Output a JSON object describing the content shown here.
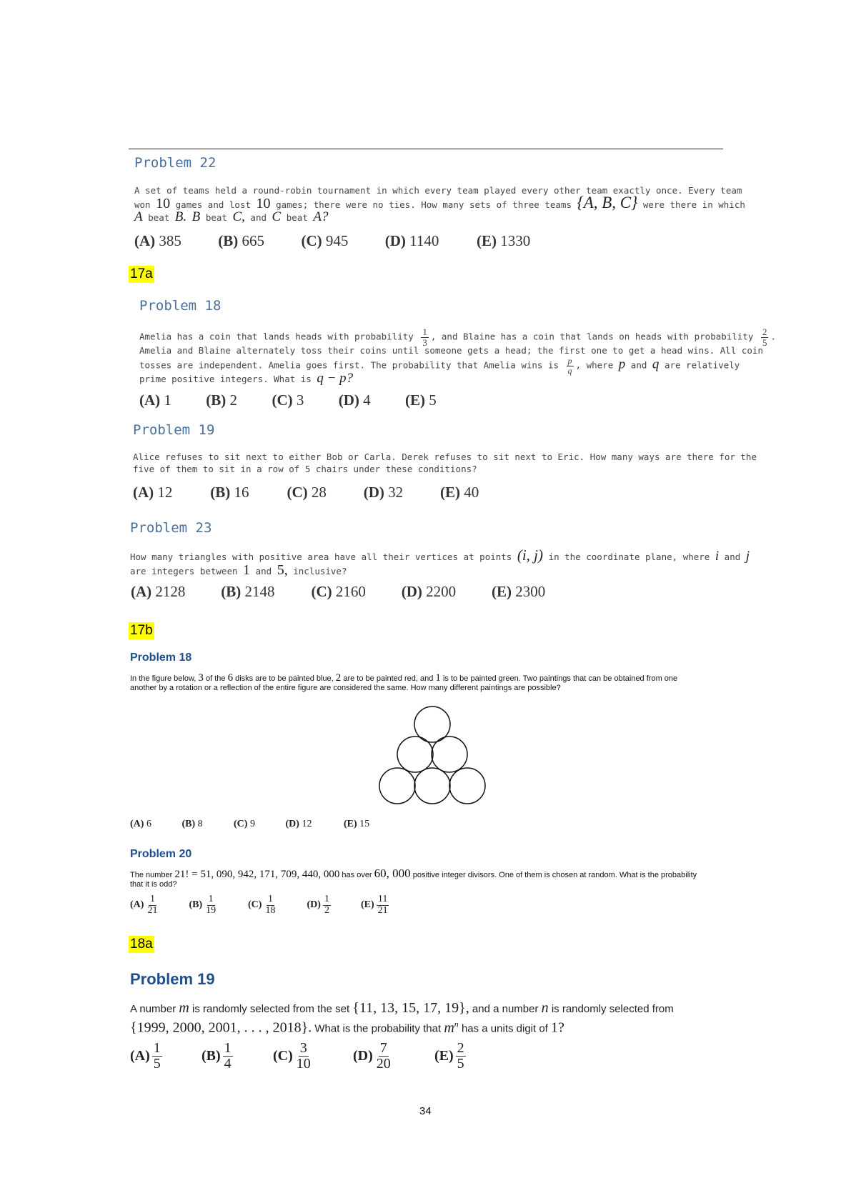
{
  "p22": {
    "title": "Problem 22",
    "line1": "A set of teams held a round-robin tournament in which every team played every other team exactly once. Every team",
    "line2a": "won",
    "n10a": "10",
    "line2b": "games and lost",
    "n10b": "10",
    "line2c": "games; there were no ties. How many sets of three teams",
    "set": "{A, B, C}",
    "line2d": "were there in which",
    "A1": "A",
    "beat1": "beat",
    "B1": "B.",
    "B2": "B",
    "beat2": "beat",
    "C1": "C,",
    "and1": "and",
    "C2": "C",
    "beat3": "beat",
    "A2": "A?",
    "choices": [
      {
        "letter": "(A)",
        "value": "385"
      },
      {
        "letter": "(B)",
        "value": "665"
      },
      {
        "letter": "(C)",
        "value": "945"
      },
      {
        "letter": "(D)",
        "value": "1140"
      },
      {
        "letter": "(E)",
        "value": "1330"
      }
    ]
  },
  "tag17a": "17a",
  "p18a": {
    "title": "Problem 18",
    "l1a": "Amelia has a coin that lands heads with probability",
    "f1n": "1",
    "f1d": "3",
    "comma1": ",",
    "l1b": "and Blaine has a coin that lands on heads with probability",
    "f2n": "2",
    "f2d": "5",
    "dot1": ".",
    "l2": "Amelia and Blaine alternately toss their coins until someone gets a head; the first one to get a head wins. All coin",
    "l3a": "tosses are independent. Amelia goes first. The probability that Amelia wins is",
    "f3n": "p",
    "f3d": "q",
    "comma3": ",",
    "l3b": "where",
    "p": "p",
    "and": "and",
    "q": "q",
    "l3c": "are relatively",
    "l4a": "prime positive integers. What is",
    "expr": "q − p?",
    "choices": [
      {
        "letter": "(A)",
        "value": "1"
      },
      {
        "letter": "(B)",
        "value": "2"
      },
      {
        "letter": "(C)",
        "value": "3"
      },
      {
        "letter": "(D)",
        "value": "4"
      },
      {
        "letter": "(E)",
        "value": "5"
      }
    ]
  },
  "p19a": {
    "title": "Problem 19",
    "l1": "Alice refuses to sit next to either Bob or Carla. Derek refuses to sit next to Eric. How many ways are there for the",
    "l2": "five of them to sit in a row of 5 chairs under these conditions?",
    "choices": [
      {
        "letter": "(A)",
        "value": "12"
      },
      {
        "letter": "(B)",
        "value": "16"
      },
      {
        "letter": "(C)",
        "value": "28"
      },
      {
        "letter": "(D)",
        "value": "32"
      },
      {
        "letter": "(E)",
        "value": "40"
      }
    ]
  },
  "p23": {
    "title": "Problem 23",
    "l1a": "How many triangles with positive area have all their vertices at points",
    "pt": "(i, j)",
    "l1b": "in the coordinate plane, where",
    "i": "i",
    "and": "and",
    "j": "j",
    "l2a": "are integers between",
    "n1": "1",
    "and2": "and",
    "n5": "5,",
    "l2b": "inclusive?",
    "choices": [
      {
        "letter": "(A)",
        "value": "2128"
      },
      {
        "letter": "(B)",
        "value": "2148"
      },
      {
        "letter": "(C)",
        "value": "2160"
      },
      {
        "letter": "(D)",
        "value": "2200"
      },
      {
        "letter": "(E)",
        "value": "2300"
      }
    ]
  },
  "tag17b": "17b",
  "p18b": {
    "title": "Problem 18",
    "l1a": "In the figure below,",
    "n3": "3",
    "l1b": "of the",
    "n6": "6",
    "l1c": "disks are to be painted blue,",
    "n2": "2",
    "l1d": "are to be painted red, and",
    "n1": "1",
    "l1e": "is to be painted green. Two paintings that can be obtained from one",
    "l2": "another by a rotation or a reflection of the entire figure are considered the same. How many different paintings are possible?",
    "choices": [
      {
        "letter": "(A)",
        "value": "6"
      },
      {
        "letter": "(B)",
        "value": "8"
      },
      {
        "letter": "(C)",
        "value": "9"
      },
      {
        "letter": "(D)",
        "value": "12"
      },
      {
        "letter": "(E)",
        "value": "15"
      }
    ]
  },
  "p20": {
    "title": "Problem 20",
    "l1a": "The number",
    "expr": "21! = 51, 090, 942, 171, 709, 440, 000",
    "l1b": "has over",
    "n": "60, 000",
    "l1c": "positive integer divisors. One of them is chosen at random. What is the probability",
    "l2": "that it is odd?",
    "choices": [
      {
        "letter": "(A)",
        "num": "1",
        "den": "21"
      },
      {
        "letter": "(B)",
        "num": "1",
        "den": "19"
      },
      {
        "letter": "(C)",
        "num": "1",
        "den": "18"
      },
      {
        "letter": "(D)",
        "num": "1",
        "den": "2"
      },
      {
        "letter": "(E)",
        "num": "11",
        "den": "21"
      }
    ]
  },
  "tag18a": "18a",
  "p19b": {
    "title": "Problem 19",
    "l1a": "A number",
    "m": "m",
    "l1b": "is randomly selected from the set",
    "set1": "{11, 13, 15, 17, 19},",
    "l1c": "and a number",
    "n": "n",
    "l1d": "is randomly selected from",
    "set2": "{1999, 2000, 2001, . . . , 2018}.",
    "l2a": "What is the probability that",
    "mn_base": "m",
    "mn_exp": "n",
    "l2b": "has a units digit of",
    "one": "1?",
    "choices": [
      {
        "letter": "(A)",
        "num": "1",
        "den": "5"
      },
      {
        "letter": "(B)",
        "num": "1",
        "den": "4"
      },
      {
        "letter": "(C)",
        "num": "3",
        "den": "10"
      },
      {
        "letter": "(D)",
        "num": "7",
        "den": "20"
      },
      {
        "letter": "(E)",
        "num": "2",
        "den": "5"
      }
    ]
  },
  "page_number": "34"
}
